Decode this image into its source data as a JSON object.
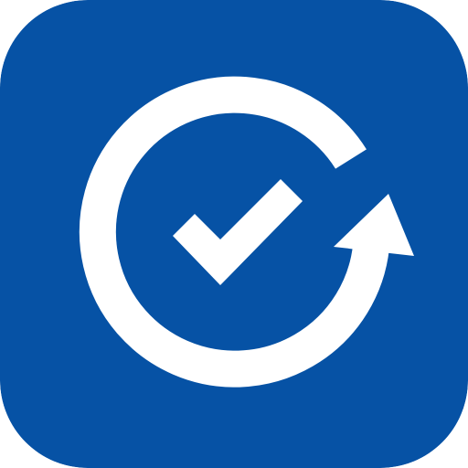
{
  "app_icon": {
    "icon": "sync-check-icon",
    "glyphs": [
      "refresh-arrow-icon",
      "checkmark-icon"
    ],
    "colors": {
      "background": "#0652A5",
      "glyph": "#FFFFFF"
    }
  }
}
